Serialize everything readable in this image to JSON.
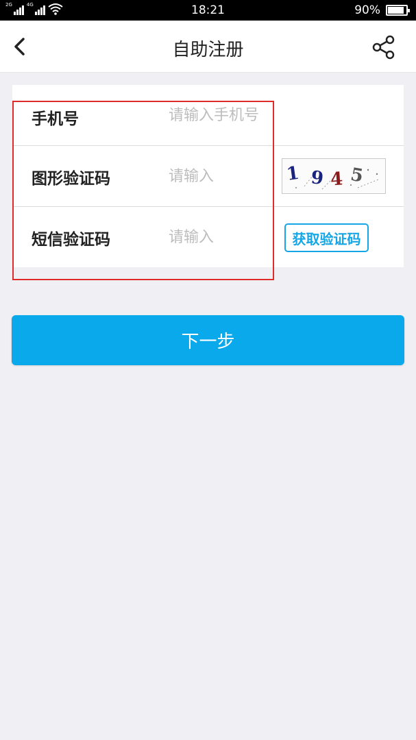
{
  "status_bar": {
    "network_1": "2G",
    "network_2": "4G",
    "time": "18:21",
    "battery_percent": "90%",
    "battery_level": 0.9
  },
  "nav": {
    "title": "自助注册",
    "back_icon": "chevron-left-icon",
    "share_icon": "share-icon"
  },
  "form": {
    "phone": {
      "label": "手机号",
      "placeholder": "请输入手机号",
      "value": ""
    },
    "image_captcha": {
      "label": "图形验证码",
      "placeholder": "请输入",
      "value": "",
      "captcha_digits": [
        "1",
        "9",
        "4",
        "5"
      ],
      "captcha_colors": [
        "#1a237e",
        "#1a237e",
        "#8b1a1a",
        "#555555"
      ]
    },
    "sms_code": {
      "label": "短信验证码",
      "placeholder": "请输入",
      "value": "",
      "button_label": "获取验证码"
    }
  },
  "colors": {
    "accent": "#0aa9ec",
    "sms_button": "#14a6e6",
    "highlight": "#e02b2b",
    "background": "#efeff4"
  },
  "next_button": {
    "label": "下一步"
  }
}
